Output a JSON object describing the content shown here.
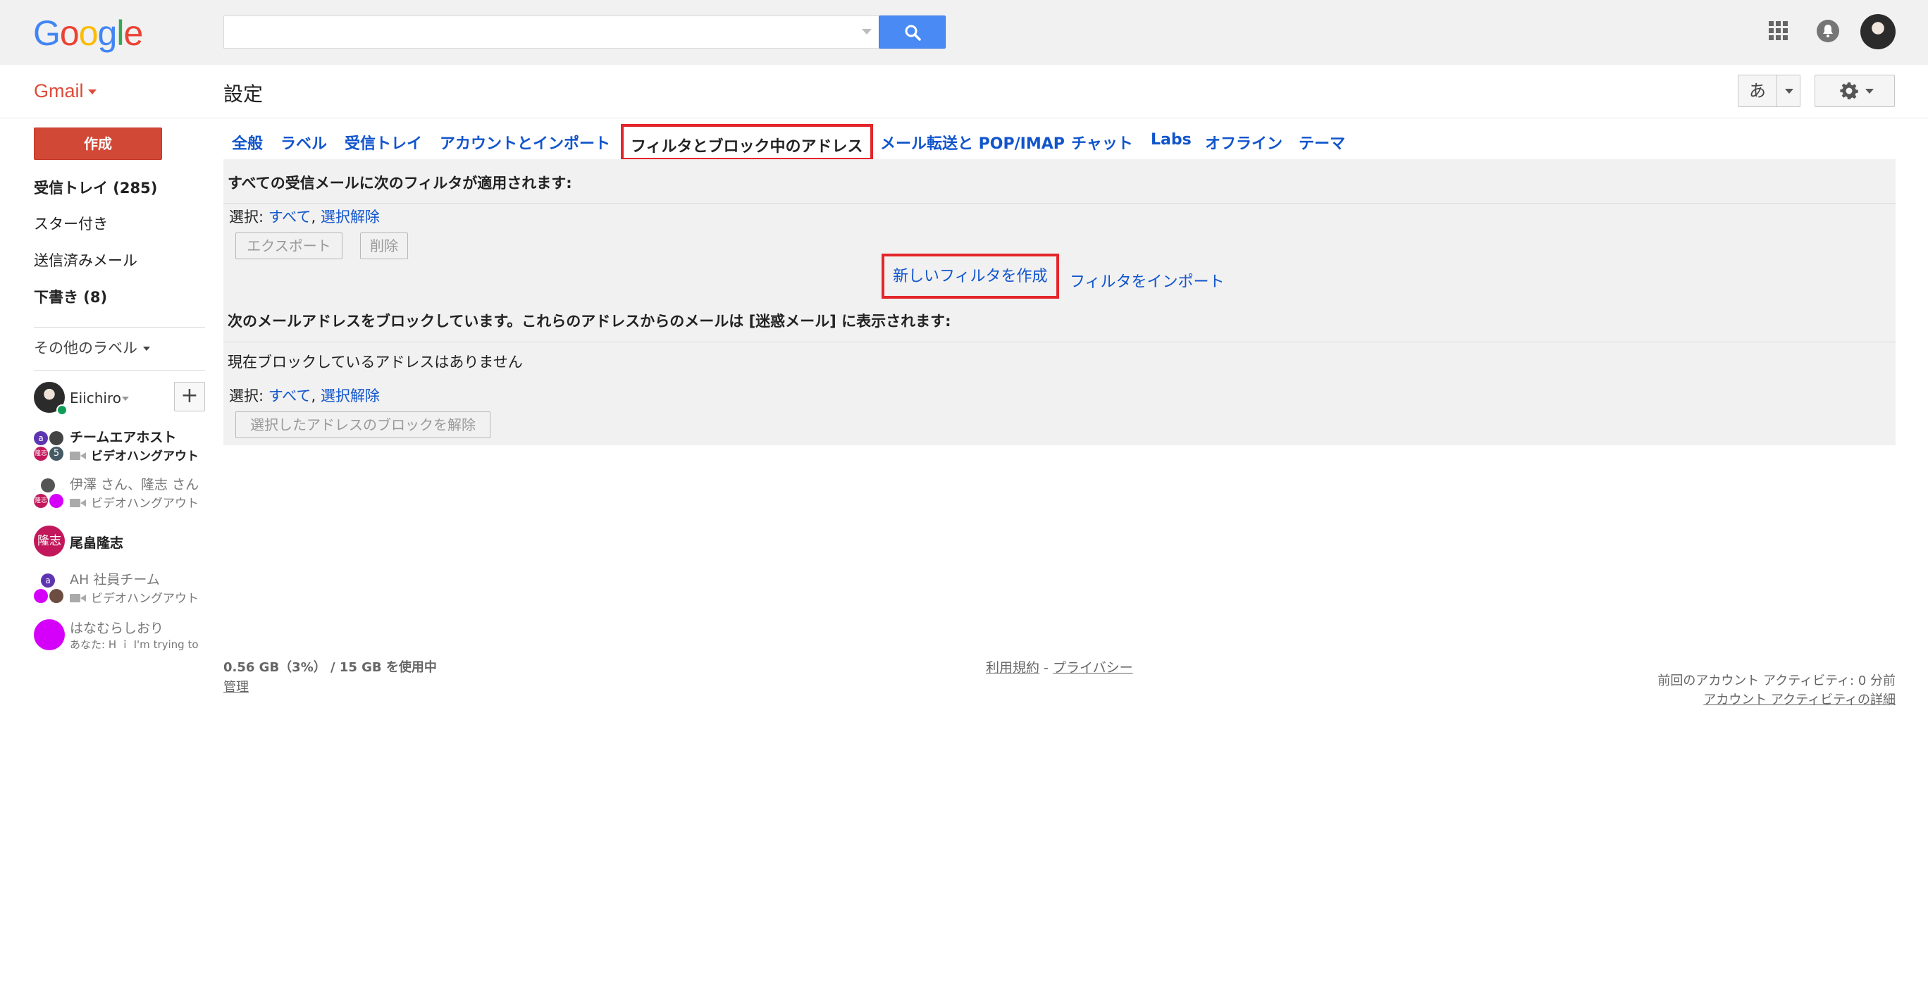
{
  "header": {
    "logo_letters": [
      {
        "char": "G",
        "color": "#4285f4"
      },
      {
        "char": "o",
        "color": "#ea4335"
      },
      {
        "char": "o",
        "color": "#fbbc05"
      },
      {
        "char": "g",
        "color": "#4285f4"
      },
      {
        "char": "l",
        "color": "#34a853"
      },
      {
        "char": "e",
        "color": "#ea4335"
      }
    ],
    "search_value": "",
    "search_placeholder": ""
  },
  "subbar": {
    "app_label": "Gmail",
    "page_title": "設定",
    "ime_label": "あ"
  },
  "sidebar": {
    "compose_label": "作成",
    "items": [
      {
        "label": "受信トレイ (285)",
        "bold": true
      },
      {
        "label": "スター付き",
        "bold": false
      },
      {
        "label": "送信済みメール",
        "bold": false
      },
      {
        "label": "下書き (8)",
        "bold": true
      }
    ],
    "more_labels": "その他のラベル",
    "user_name": "Eiichiro",
    "hangouts": [
      {
        "title": "チームエアホスト",
        "subtitle": "ビデオハングアウト",
        "bold": true,
        "badge": "5",
        "badge_small": "隆志"
      },
      {
        "title": "伊澤 さん、隆志 さん",
        "subtitle": "ビデオハングアウト",
        "bold": false,
        "badge_small": "隆志"
      },
      {
        "title": "尾畠隆志",
        "subtitle": "",
        "bold": true,
        "avatar_text": "隆志"
      },
      {
        "title": "AH 社員チーム",
        "subtitle": "ビデオハングアウト",
        "bold": false
      },
      {
        "title": "はなむらしおり",
        "subtitle": "あなた: H ｉ I'm trying to",
        "bold": false
      }
    ],
    "hangout_avatar_a": "a"
  },
  "tabs": [
    {
      "label": "全般",
      "active": false
    },
    {
      "label": "ラベル",
      "active": false
    },
    {
      "label": "受信トレイ",
      "active": false
    },
    {
      "label": "アカウントとインポート",
      "active": false
    },
    {
      "label": "フィルタとブロック中のアドレス",
      "active": true
    },
    {
      "label": "メール転送と POP/IMAP",
      "active": false
    },
    {
      "label": "チャット",
      "active": false
    },
    {
      "label": "Labs",
      "active": false
    },
    {
      "label": "オフライン",
      "active": false
    },
    {
      "label": "テーマ",
      "active": false
    }
  ],
  "filters": {
    "heading": "すべての受信メールに次のフィルタが適用されます:",
    "select_prefix": "選択: ",
    "select_all": "すべて",
    "select_comma": ", ",
    "select_none": "選択解除",
    "export_label": "エクスポート",
    "delete_label": "削除",
    "create_filter": "新しいフィルタを作成",
    "import_filter": "フィルタをインポート"
  },
  "blocked": {
    "heading": "次のメールアドレスをブロックしています。これらのアドレスからのメールは [迷惑メール] に表示されます:",
    "empty_text": "現在ブロックしているアドレスはありません",
    "select_prefix": "選択: ",
    "select_all": "すべて",
    "select_comma": ", ",
    "select_none": "選択解除",
    "unblock_label": "選択したアドレスのブロックを解除"
  },
  "footer": {
    "usage": "0.56 GB（3%） / 15 GB を使用中",
    "manage": "管理",
    "terms": "利用規約",
    "dash": " - ",
    "privacy": "プライバシー",
    "last_activity": "前回のアカウント アクティビティ: 0 分前",
    "activity_details": "アカウント アクティビティの詳細"
  }
}
